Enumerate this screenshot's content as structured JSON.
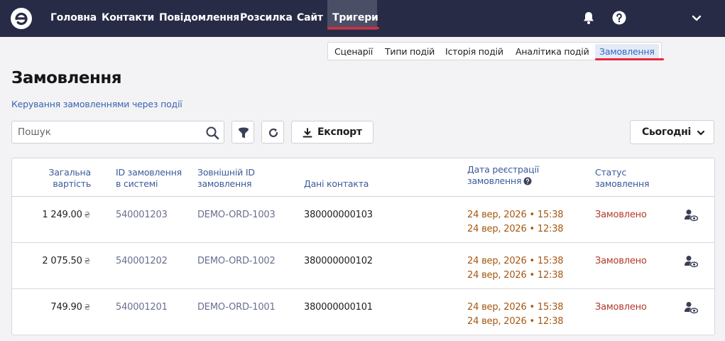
{
  "nav": {
    "items": [
      {
        "label": "Головна"
      },
      {
        "label": "Контакти"
      },
      {
        "label": "Повідомлення"
      },
      {
        "label": "Розсилка"
      },
      {
        "label": "Сайт"
      },
      {
        "label": "Тригери",
        "active": true
      }
    ],
    "icons": [
      "logo-icon",
      "bell-icon",
      "help-icon",
      "chevron-down-icon"
    ]
  },
  "subtabs": [
    {
      "label": "Сценарії"
    },
    {
      "label": "Типи подій"
    },
    {
      "label": "Історія подій"
    },
    {
      "label": "Аналітика подій"
    },
    {
      "label": "Замовлення",
      "active": true
    }
  ],
  "page": {
    "title": "Замовлення",
    "subtitle": "Керування замовленнями через події"
  },
  "toolbar": {
    "search_placeholder": "Пошук",
    "export_label": "Експорт",
    "period_label": "Сьогодні",
    "icons": [
      "search-icon",
      "filter-icon",
      "refresh-icon",
      "download-icon"
    ]
  },
  "table": {
    "headers": {
      "amount_1": "Загальна",
      "amount_2": "вартість",
      "sys_id_1": "ID замовлення",
      "sys_id_2": "в системі",
      "ext_id_1": "Зовнішній ID",
      "ext_id_2": "замовлення",
      "contact": "Дані контакта",
      "date_1": "Дата реєстрації",
      "date_2": "замовлення",
      "status_1": "Статус",
      "status_2": "замовлення"
    },
    "currency": "₴",
    "rows": [
      {
        "amount": "1 249.00",
        "sys_id": "540001203",
        "ext_id": "DEMO-ORD-1003",
        "contact": "380000000103",
        "date_1": "24 вер, 2026 • 15:38",
        "date_2": "24 вер, 2026 • 12:38",
        "status": "Замовлено"
      },
      {
        "amount": "2 075.50",
        "sys_id": "540001202",
        "ext_id": "DEMO-ORD-1002",
        "contact": "380000000102",
        "date_1": "24 вер, 2026 • 15:38",
        "date_2": "24 вер, 2026 • 12:38",
        "status": "Замовлено"
      },
      {
        "amount": "749.90",
        "sys_id": "540001201",
        "ext_id": "DEMO-ORD-1001",
        "contact": "380000000101",
        "date_1": "24 вер, 2026 • 15:38",
        "date_2": "24 вер, 2026 • 12:38",
        "status": "Замовлено"
      }
    ]
  },
  "colors": {
    "topbar": "#272b46",
    "accent_red": "#e8273a",
    "link_blue": "#3566c3",
    "date_orange": "#a5570f",
    "status_red": "#b23a2a"
  }
}
